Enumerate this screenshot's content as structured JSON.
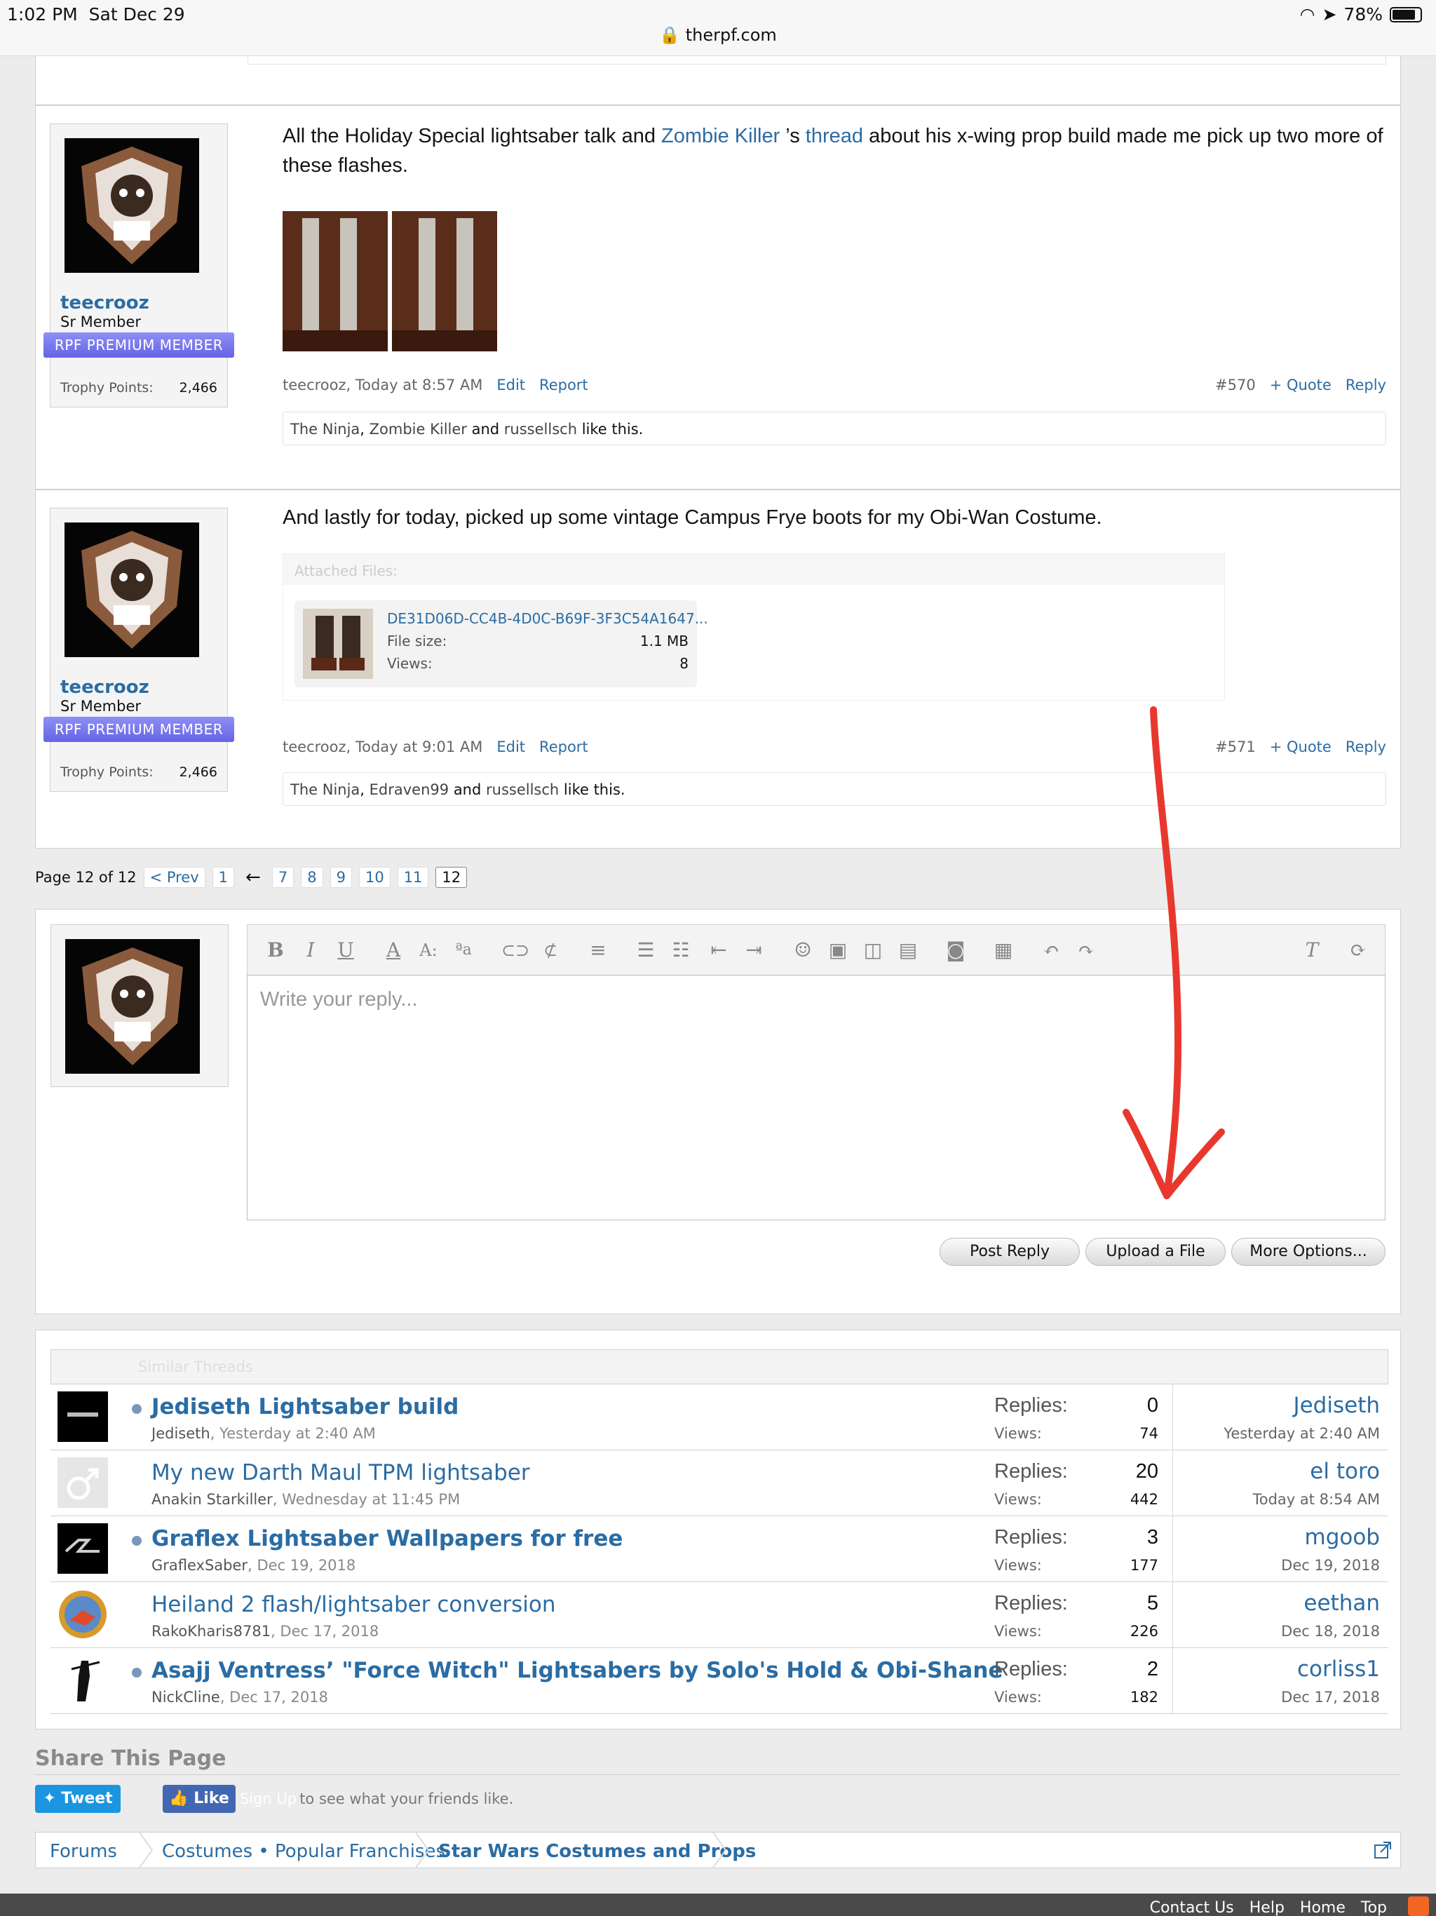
{
  "status_bar": {
    "time": "1:02 PM",
    "date": "Sat Dec 29",
    "url": "therpf.com",
    "battery": "78%"
  },
  "posts": [
    {
      "username": "teecrooz",
      "user_title": "Sr Member",
      "badge": "RPF PREMIUM MEMBER",
      "trophy_label": "Trophy Points:",
      "trophy_value": "2,466",
      "message_parts": [
        "All the Holiday Special lightsaber talk and ",
        "Zombie Killer",
        " ’s ",
        "thread",
        " about his x-wing prop build made me pick up two more of these flashes."
      ],
      "meta_author_time": "teecrooz, Today at 8:57 AM",
      "edit": "Edit",
      "report": "Report",
      "post_number": "#570",
      "quote": "+ Quote",
      "reply": "Reply",
      "likes": {
        "name1": "The Ninja",
        "sep": ", ",
        "name2": "Zombie Killer",
        "and": " and ",
        "name3": "russellsch",
        "suffix": " like this."
      }
    },
    {
      "username": "teecrooz",
      "user_title": "Sr Member",
      "badge": "RPF PREMIUM MEMBER",
      "trophy_label": "Trophy Points:",
      "trophy_value": "2,466",
      "message": "And lastly for today, picked up some vintage Campus Frye boots for my Obi-Wan Costume.",
      "attached_label": "Attached Files:",
      "attachment": {
        "name": "DE31D06D-CC4B-4D0C-B69F-3F3C54A1647...",
        "size_label": "File size:",
        "size": "1.1 MB",
        "views_label": "Views:",
        "views": "8"
      },
      "meta_author_time": "teecrooz, Today at 9:01 AM",
      "edit": "Edit",
      "report": "Report",
      "post_number": "#571",
      "quote": "+ Quote",
      "reply": "Reply",
      "likes": {
        "name1": "The Ninja",
        "sep": ", ",
        "name2": "Edraven99",
        "and": " and ",
        "name3": "russellsch",
        "suffix": " like this."
      }
    }
  ],
  "pagination": {
    "label": "Page 12 of 12",
    "prev": "< Prev",
    "first": "1",
    "ellipsis": "←",
    "pages": [
      "7",
      "8",
      "9",
      "10",
      "11",
      "12"
    ],
    "current": "12"
  },
  "editor": {
    "placeholder": "Write your reply...",
    "post_reply": "Post Reply",
    "upload": "Upload a File",
    "more": "More Options..."
  },
  "similar": {
    "heading": "Similar Threads",
    "replies_label": "Replies:",
    "views_label": "Views:",
    "threads": [
      {
        "title": "Jediseth Lightsaber build",
        "bold": true,
        "author": "Jediseth",
        "date": "Yesterday at 2:40 AM",
        "replies": "0",
        "views": "74",
        "last_user": "Jediseth",
        "last_date": "Yesterday at 2:40 AM",
        "thumb": "jediseth"
      },
      {
        "title": "My new Darth Maul TPM lightsaber",
        "bold": false,
        "author": "Anakin Starkiller",
        "date": "Wednesday at 11:45 PM",
        "replies": "20",
        "views": "442",
        "last_user": "el toro",
        "last_date": "Today at 8:54 AM",
        "thumb": "male"
      },
      {
        "title": "Graflex Lightsaber Wallpapers for free",
        "bold": true,
        "author": "GraflexSaber",
        "date": "Dec 19, 2018",
        "replies": "3",
        "views": "177",
        "last_user": "mgoob",
        "last_date": "Dec 19, 2018",
        "thumb": "graflex"
      },
      {
        "title": "Heiland 2 flash/lightsaber conversion",
        "bold": false,
        "author": "RakoKharis8781",
        "date": "Dec 17, 2018",
        "replies": "5",
        "views": "226",
        "last_user": "eethan",
        "last_date": "Dec 18, 2018",
        "thumb": "circle"
      },
      {
        "title": "Asajj Ventress’ \"Force Witch\" Lightsabers by Solo's Hold & Obi-Shane",
        "bold": true,
        "author": "NickCline",
        "date": "Dec 17, 2018",
        "replies": "2",
        "views": "182",
        "last_user": "corliss1",
        "last_date": "Dec 17, 2018",
        "thumb": "figure"
      }
    ]
  },
  "share": {
    "title": "Share This Page",
    "tweet": "Tweet",
    "like": "Like",
    "signup": "Sign Up",
    "friends": "to see what your friends like."
  },
  "breadcrumb": [
    "Forums",
    "Costumes • Popular Franchises",
    "Star Wars Costumes and Props"
  ],
  "footer": [
    "Contact Us",
    "Help",
    "Home",
    "Top"
  ],
  "colors": {
    "link": "#2b6ca3",
    "badge": "#7878f0",
    "annotation": "#e8382e",
    "tweet": "#1b95e0",
    "fb": "#4267b2"
  }
}
